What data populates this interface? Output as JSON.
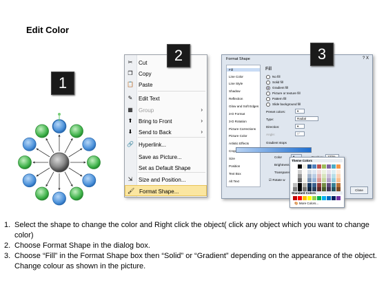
{
  "title": "Edit Color",
  "badges": [
    "1",
    "2",
    "3"
  ],
  "colors": {
    "blue_node": "#4a90d9",
    "green_node": "#3fb24a",
    "center": "#8a8a8a",
    "menu_highlight": "#fbe6a0"
  },
  "context_menu": {
    "items": [
      {
        "label": "Cut",
        "icon": "scissors-icon",
        "disabled": false,
        "submenu": false
      },
      {
        "label": "Copy",
        "icon": "copy-icon",
        "disabled": false,
        "submenu": false
      },
      {
        "label": "Paste",
        "icon": "paste-icon",
        "disabled": false,
        "submenu": false
      },
      {
        "label": "Edit Text",
        "icon": "edit-text-icon",
        "disabled": false,
        "submenu": false
      },
      {
        "label": "Group",
        "icon": "group-icon",
        "disabled": true,
        "submenu": true
      },
      {
        "label": "Bring to Front",
        "icon": "bring-front-icon",
        "disabled": false,
        "submenu": true
      },
      {
        "label": "Send to Back",
        "icon": "send-back-icon",
        "disabled": false,
        "submenu": true
      },
      {
        "label": "Hyperlink...",
        "icon": "hyperlink-icon",
        "disabled": false,
        "submenu": false
      },
      {
        "label": "Save as Picture...",
        "icon": "",
        "disabled": false,
        "submenu": false
      },
      {
        "label": "Set as Default Shape",
        "icon": "",
        "disabled": false,
        "submenu": false
      },
      {
        "label": "Size and Position...",
        "icon": "size-position-icon",
        "disabled": false,
        "submenu": false
      },
      {
        "label": "Format Shape...",
        "icon": "format-shape-icon",
        "disabled": false,
        "submenu": false,
        "highlighted": true
      }
    ]
  },
  "dialog": {
    "title": "Format Shape",
    "close_x": "?  X",
    "categories": [
      "Fill",
      "Line Color",
      "Line Style",
      "Shadow",
      "Reflection",
      "Glow and Soft Edges",
      "3-D Format",
      "3-D Rotation",
      "Picture Corrections",
      "Picture Color",
      "Artistic Effects",
      "Crop",
      "Size",
      "Position",
      "Text Box",
      "Alt Text"
    ],
    "selected_category": "Fill",
    "pane_heading": "Fill",
    "fill_options": [
      "No fill",
      "Solid fill",
      "Gradient fill",
      "Picture or texture fill",
      "Pattern fill",
      "Slide background fill"
    ],
    "selected_fill": "Gradient fill",
    "preset_colors_label": "Preset colors:",
    "type_label": "Type:",
    "type_value": "Radial",
    "direction_label": "Direction:",
    "angle_label": "Angle:",
    "angle_value": "0°",
    "gradient_stops_label": "Gradient stops",
    "color_label": "Color",
    "position_label": "Position:",
    "position_value": "100%",
    "brightness_label": "Brightness",
    "transparency_label": "Transparen",
    "rotate_label": "Rotate w",
    "close_button": "Close"
  },
  "palette": {
    "theme_heading": "Theme Colors",
    "standard_heading": "Standard Colors",
    "more_label": "More Colors...",
    "theme_top": [
      "#ffffff",
      "#000000",
      "#eeece1",
      "#1f497d",
      "#4f81bd",
      "#c0504d",
      "#9bbb59",
      "#8064a2",
      "#4bacc6",
      "#f79646"
    ],
    "standard": [
      "#c00000",
      "#ff0000",
      "#ffc000",
      "#ffff00",
      "#92d050",
      "#00b050",
      "#00b0f0",
      "#0070c0",
      "#002060",
      "#7030a0"
    ]
  },
  "steps": [
    {
      "num": "1.",
      "text": "Select the shape to change the color and Right click the object( click any object which you want to change color)"
    },
    {
      "num": "2.",
      "text": "Choose Format Shape in the dialog box."
    },
    {
      "num": "3.",
      "text": "Choose “Fill” in the Format Shape box then “Solid” or “Gradient” depending on the appearance of the object. Change colour as shown in the picture."
    }
  ]
}
